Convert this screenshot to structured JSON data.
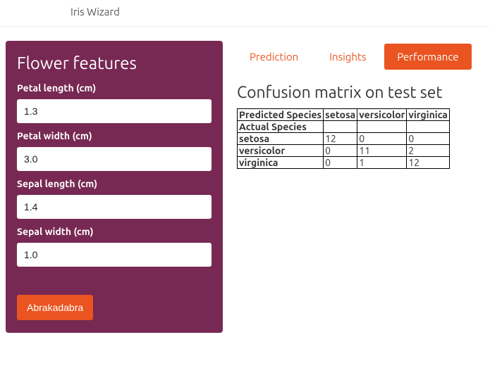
{
  "app_title": "Iris Wizard",
  "sidebar": {
    "title": "Flower features",
    "fields": [
      {
        "label": "Petal length (cm)",
        "value": "1.3"
      },
      {
        "label": "Petal width (cm)",
        "value": "3.0"
      },
      {
        "label": "Sepal length (cm)",
        "value": "1.4"
      },
      {
        "label": "Sepal width (cm)",
        "value": "1.0"
      }
    ],
    "action_label": "Abrakadabra"
  },
  "tabs": [
    {
      "label": "Prediction",
      "active": false
    },
    {
      "label": "Insights",
      "active": false
    },
    {
      "label": "Performance",
      "active": true
    }
  ],
  "main": {
    "heading": "Confusion matrix on test set",
    "table": {
      "header_row": [
        "Predicted Species",
        "setosa",
        "versicolor",
        "virginica"
      ],
      "rows": [
        [
          "Actual Species",
          "",
          "",
          ""
        ],
        [
          "setosa",
          "12",
          "0",
          "0"
        ],
        [
          "versicolor",
          "0",
          "11",
          "2"
        ],
        [
          "virginica",
          "0",
          "1",
          "12"
        ]
      ]
    }
  }
}
